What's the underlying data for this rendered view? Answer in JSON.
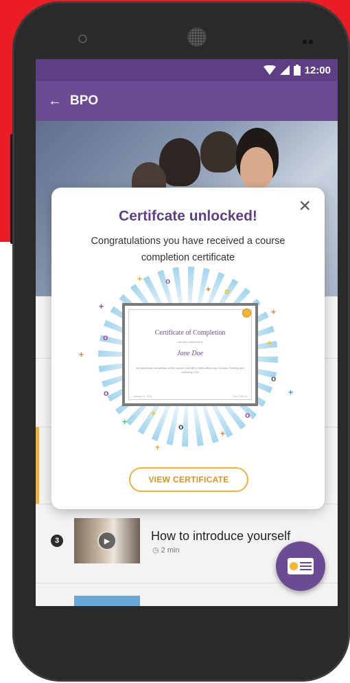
{
  "status_bar": {
    "time": "12:00"
  },
  "app_bar": {
    "title": "BPO"
  },
  "modal": {
    "title": "Certifcate unlocked!",
    "subtitle": "Congratulations you have received a course completion certificate",
    "button": "VIEW CERTIFICATE"
  },
  "certificate": {
    "heading": "Certificate of Completion",
    "awarded": "has been awarded to",
    "name": "Jane Doe",
    "description": "for successful completion of the course Core BPO Skills offered by Contoso Training and receiving 70%",
    "date": "January 09, 2018",
    "id": "Cert-2738416"
  },
  "lessons": [
    {
      "number": "3",
      "title": "How to introduce yourself",
      "duration": "2 min"
    }
  ],
  "colors": {
    "brand_purple": "#6b4b94",
    "accent_orange": "#f0b03a",
    "background_red": "#ea1c24"
  }
}
